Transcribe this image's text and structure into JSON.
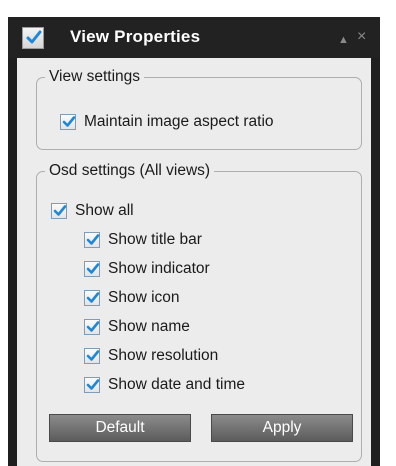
{
  "window": {
    "title": "View Properties",
    "title_icon": "checkbox-app-icon",
    "collapse_glyph": "▲",
    "close_glyph": "×"
  },
  "view_settings": {
    "legend": "View settings",
    "options": [
      {
        "label": "Maintain image aspect ratio",
        "checked": true
      }
    ]
  },
  "osd_settings": {
    "legend": "Osd settings (All views)",
    "show_all": {
      "label": "Show all",
      "checked": true
    },
    "options": [
      {
        "label": "Show title bar",
        "checked": true
      },
      {
        "label": "Show indicator",
        "checked": true
      },
      {
        "label": "Show icon",
        "checked": true
      },
      {
        "label": "Show name",
        "checked": true
      },
      {
        "label": "Show resolution",
        "checked": true
      },
      {
        "label": "Show date and time",
        "checked": true
      }
    ]
  },
  "buttons": {
    "default_label": "Default",
    "apply_label": "Apply"
  },
  "colors": {
    "title_bar": "#222222",
    "panel_bg": "#ececec",
    "check_mark": "#1e88d6",
    "button_bg": "#6f6f6f"
  }
}
